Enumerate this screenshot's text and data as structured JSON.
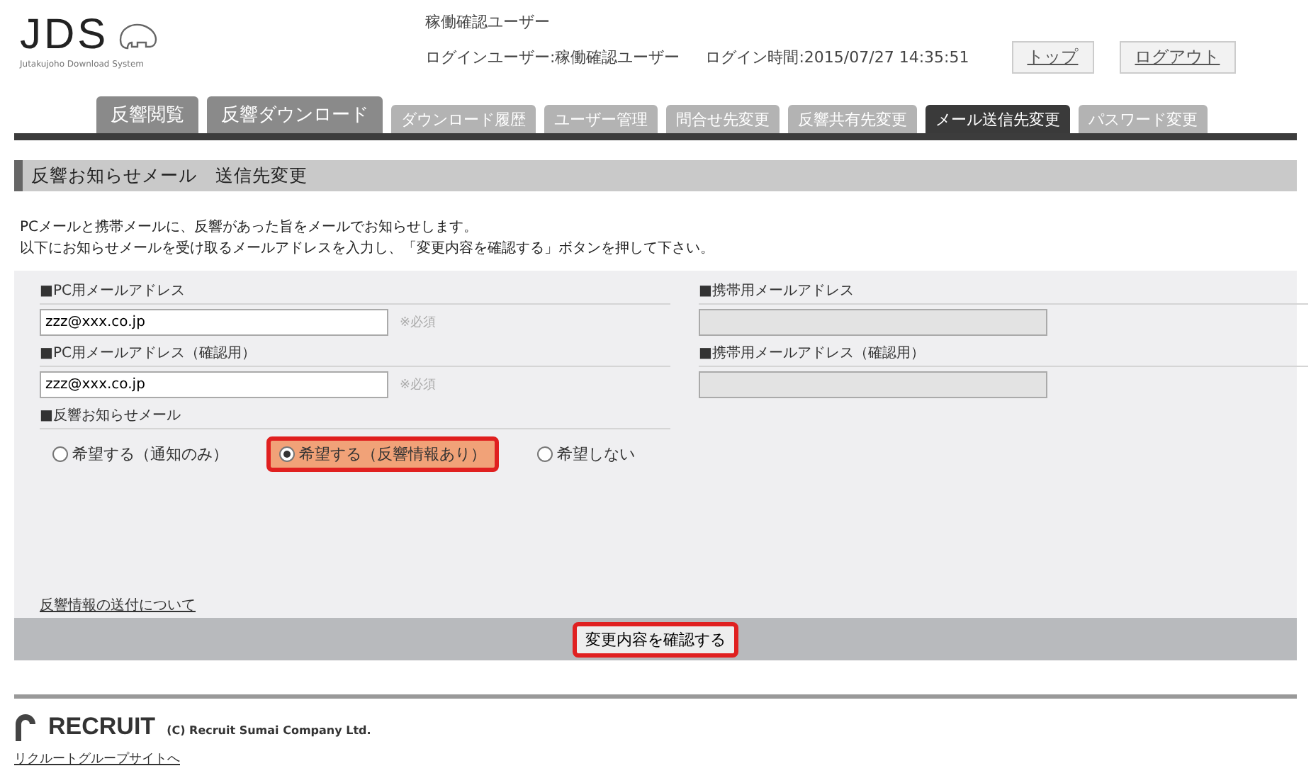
{
  "logo": {
    "text": "JDS",
    "subtitle": "Jutakujoho Download System"
  },
  "header": {
    "user_name": "稼働確認ユーザー",
    "login_user": "ログインユーザー:稼働確認ユーザー",
    "login_time": "ログイン時間:2015/07/27 14:35:51",
    "buttons": [
      "トップ",
      "ログアウト"
    ]
  },
  "tabs": [
    {
      "label": "反響閲覧",
      "kind": "primary",
      "selected": false
    },
    {
      "label": "反響ダウンロード",
      "kind": "primary",
      "selected": false
    },
    {
      "label": "ダウンロード履歴",
      "kind": "secondary",
      "selected": false
    },
    {
      "label": "ユーザー管理",
      "kind": "secondary",
      "selected": false
    },
    {
      "label": "問合せ先変更",
      "kind": "secondary",
      "selected": false
    },
    {
      "label": "反響共有先変更",
      "kind": "secondary",
      "selected": false
    },
    {
      "label": "メール送信先変更",
      "kind": "secondary",
      "selected": true
    },
    {
      "label": "パスワード変更",
      "kind": "secondary",
      "selected": false
    }
  ],
  "section_title": "反響お知らせメール　送信先変更",
  "description": [
    "PCメールと携帯メールに、反響があった旨をメールでお知らせします。",
    "以下にお知らせメールを受け取るメールアドレスを入力し、「変更内容を確認する」ボタンを押して下さい。"
  ],
  "form": {
    "fields": [
      {
        "label": "■PC用メールアドレス",
        "value": "zzz@xxx.co.jp",
        "note": "※必須",
        "disabled": false
      },
      {
        "label": "■携帯用メールアドレス",
        "disabled": true
      },
      {
        "label": "■PC用メールアドレス（確認用）",
        "value": "zzz@xxx.co.jp",
        "note": "※必須",
        "disabled": false
      },
      {
        "label": "■携帯用メールアドレス（確認用）",
        "disabled": true
      }
    ],
    "notification_label": "■反響お知らせメール",
    "options": [
      {
        "label": "希望する（通知のみ）",
        "selected": false,
        "highlighted": false
      },
      {
        "label": "希望する（反響情報あり）",
        "selected": true,
        "highlighted": true
      },
      {
        "label": "希望しない",
        "selected": false,
        "highlighted": false
      }
    ],
    "info_link": "反響情報の送付について"
  },
  "confirm_button": {
    "label": "変更内容を確認する",
    "highlighted": true
  },
  "footer": {
    "brand": "RECRUIT",
    "copyright": "(C) Recruit Sumai Company Ltd.",
    "link": "リクルートグループサイトへ"
  }
}
